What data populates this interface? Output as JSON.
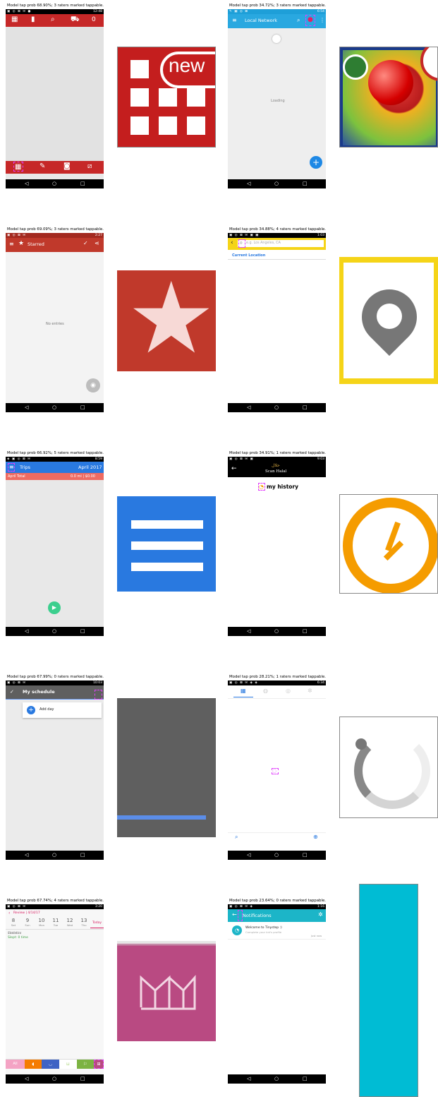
{
  "captions": [
    "Model tap prob 68.90%; 3 raters marked tappable.",
    "Model tap prob 34.72%; 3 raters marked tappable.",
    "Model tap prob 69.09%; 3 raters marked tappable.",
    "Model tap prob 34.88%; 4 raters marked tappable.",
    "Model tap prob 66.92%; 5 raters marked tappable.",
    "Model tap prob 34.91%; 1 raters marked tappable.",
    "Model tap prob 67.99%; 0 raters marked tappable.",
    "Model tap prob 28.21%; 1 raters marked tappable.",
    "Model tap prob 67.74%; 4 raters marked tappable.",
    "Model tap prob 23.64%; 0 raters marked tappable."
  ],
  "status_times": [
    "12:48",
    "6:54",
    "2:27",
    "1:03",
    "8:59",
    "9:03",
    "10:03",
    "6:34",
    "3:20",
    "1:16"
  ],
  "nav": {
    "back": "◁",
    "home": "○",
    "recents": "□"
  },
  "s1": {
    "badge_count": "0",
    "thumb_text": "new"
  },
  "s2": {
    "title": "Local Network",
    "loading": "Loading",
    "fab": "+"
  },
  "s3": {
    "title": "Starred",
    "empty": "No entries"
  },
  "s4": {
    "placeholder": "e.g. Los Angeles, CA",
    "current_location": "Current Location"
  },
  "s5": {
    "title": "Trips",
    "month": "April 2017",
    "total_label": "April Total",
    "total_value": "0.0 mi  |  $0.00"
  },
  "s6": {
    "brand_arabic": "حلال",
    "brand": "Scan Halal",
    "history": "my history"
  },
  "s7": {
    "title": "My schedule",
    "add_day": "Add day"
  },
  "s9": {
    "header": "Review | 4/14/17",
    "days": [
      {
        "num": "8",
        "name": "Sat"
      },
      {
        "num": "9",
        "name": "Sun"
      },
      {
        "num": "10",
        "name": "Mon"
      },
      {
        "num": "11",
        "name": "Tue"
      },
      {
        "num": "12",
        "name": "Wed"
      },
      {
        "num": "13",
        "name": "Thu"
      }
    ],
    "today": "Today",
    "statistics": "Statistics",
    "slept": "Slept: 0 time",
    "bottom_tabs": [
      "All"
    ]
  },
  "s10": {
    "title": "Notifications",
    "welcome": "Welcome to Tinystep :)",
    "sub": "Complete your kid's profile",
    "time": "Just now"
  },
  "colors": {
    "red": "#c62828",
    "blue": "#29a8e0",
    "material_red": "#c0392b",
    "yellow": "#f5d418",
    "trips_blue": "#2979e0",
    "trips_salmon": "#ee6b62",
    "teal": "#1cb5c8",
    "pink": "#b94a82",
    "highlight": "#e040fb"
  }
}
